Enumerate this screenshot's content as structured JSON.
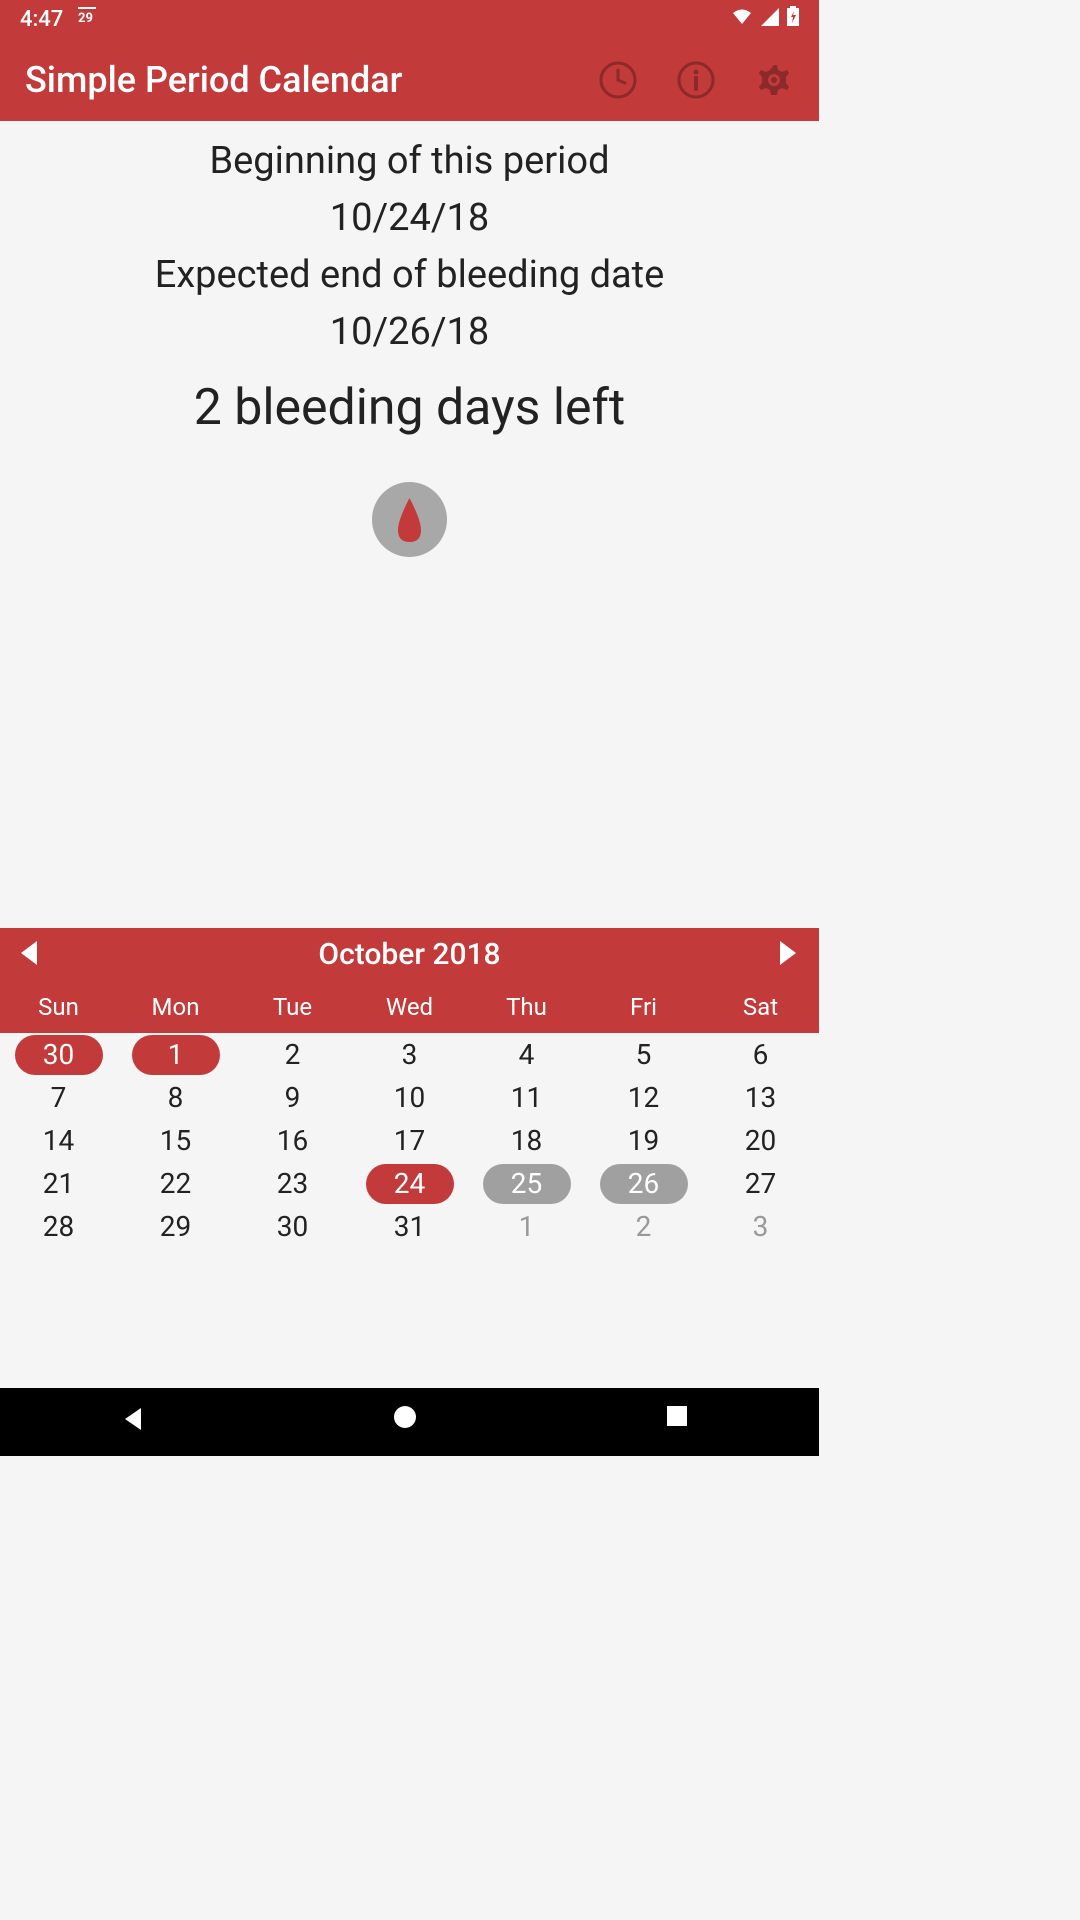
{
  "status_bar": {
    "time": "4:47",
    "temp_icon": "29"
  },
  "app_bar": {
    "title": "Simple Period Calendar"
  },
  "info": {
    "begin_label": "Beginning of this period",
    "begin_date": "10/24/18",
    "end_label": "Expected end of bleeding date",
    "end_date": "10/26/18",
    "days_left": "2 bleeding days left"
  },
  "calendar": {
    "month_label": "October 2018",
    "day_headers": [
      "Sun",
      "Mon",
      "Tue",
      "Wed",
      "Thu",
      "Fri",
      "Sat"
    ],
    "weeks": [
      [
        {
          "day": "30",
          "style": "red-pill",
          "other": false
        },
        {
          "day": "1",
          "style": "red-pill",
          "other": false
        },
        {
          "day": "2",
          "style": "normal",
          "other": false
        },
        {
          "day": "3",
          "style": "normal",
          "other": false
        },
        {
          "day": "4",
          "style": "normal",
          "other": false
        },
        {
          "day": "5",
          "style": "normal",
          "other": false
        },
        {
          "day": "6",
          "style": "normal",
          "other": false
        }
      ],
      [
        {
          "day": "7",
          "style": "normal",
          "other": false
        },
        {
          "day": "8",
          "style": "normal",
          "other": false
        },
        {
          "day": "9",
          "style": "normal",
          "other": false
        },
        {
          "day": "10",
          "style": "normal",
          "other": false
        },
        {
          "day": "11",
          "style": "normal",
          "other": false
        },
        {
          "day": "12",
          "style": "normal",
          "other": false
        },
        {
          "day": "13",
          "style": "normal",
          "other": false
        }
      ],
      [
        {
          "day": "14",
          "style": "normal",
          "other": false
        },
        {
          "day": "15",
          "style": "normal",
          "other": false
        },
        {
          "day": "16",
          "style": "normal",
          "other": false
        },
        {
          "day": "17",
          "style": "normal",
          "other": false
        },
        {
          "day": "18",
          "style": "normal",
          "other": false
        },
        {
          "day": "19",
          "style": "normal",
          "other": false
        },
        {
          "day": "20",
          "style": "normal",
          "other": false
        }
      ],
      [
        {
          "day": "21",
          "style": "normal",
          "other": false
        },
        {
          "day": "22",
          "style": "normal",
          "other": false
        },
        {
          "day": "23",
          "style": "normal",
          "other": false
        },
        {
          "day": "24",
          "style": "red-pill",
          "other": false
        },
        {
          "day": "25",
          "style": "gray-pill",
          "other": false
        },
        {
          "day": "26",
          "style": "gray-pill",
          "other": false
        },
        {
          "day": "27",
          "style": "normal",
          "other": false
        }
      ],
      [
        {
          "day": "28",
          "style": "normal",
          "other": false
        },
        {
          "day": "29",
          "style": "normal",
          "other": false
        },
        {
          "day": "30",
          "style": "normal",
          "other": false
        },
        {
          "day": "31",
          "style": "normal",
          "other": false
        },
        {
          "day": "1",
          "style": "normal",
          "other": true
        },
        {
          "day": "2",
          "style": "normal",
          "other": true
        },
        {
          "day": "3",
          "style": "normal",
          "other": true
        }
      ]
    ]
  },
  "colors": {
    "primary": "#c23a3a",
    "gray": "#a0a0a0",
    "text": "#222222"
  }
}
